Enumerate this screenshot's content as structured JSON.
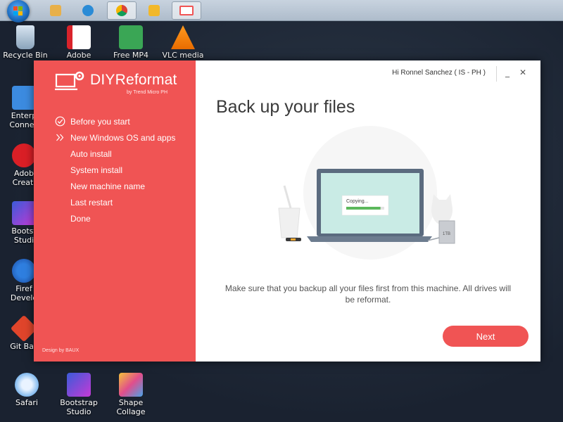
{
  "taskbar": {
    "items": [
      {
        "icon": "folder-icon",
        "color": "#e8b04a"
      },
      {
        "icon": "internet-explorer-icon",
        "color": "#2a8bd6"
      },
      {
        "icon": "chrome-icon",
        "color": "#db4437"
      },
      {
        "icon": "notes-icon",
        "color": "#f2b82a"
      },
      {
        "icon": "diyreformat-icon",
        "color": "#f05454"
      }
    ]
  },
  "desktop": {
    "icons_top": [
      {
        "label": "Recycle Bin",
        "icon": "recycle-bin-icon"
      },
      {
        "label": "Adobe",
        "icon": "adobe-icon"
      },
      {
        "label": "Free MP4",
        "icon": "free-mp4-icon"
      },
      {
        "label": "VLC media",
        "icon": "vlc-icon"
      }
    ],
    "icons_left": [
      {
        "label": "Enterp Connec",
        "icon": "enterprise-connect-icon"
      },
      {
        "label": "Adob Creati",
        "icon": "adobe-creative-icon"
      },
      {
        "label": "Bootst Studi",
        "icon": "bootstrap-studio-icon"
      },
      {
        "label": "Firef Develo",
        "icon": "firefox-developer-icon"
      },
      {
        "label": "Git Bas",
        "icon": "git-bash-icon"
      }
    ],
    "icons_bottom": [
      {
        "label": "Safari",
        "icon": "safari-icon"
      },
      {
        "label": "Bootstrap Studio",
        "icon": "bootstrap-studio-icon"
      },
      {
        "label": "Shape Collage",
        "icon": "shape-collage-icon"
      }
    ]
  },
  "app": {
    "logo": {
      "title": "DIYReformat",
      "subtitle": "by Trend Micro PH"
    },
    "steps": [
      {
        "label": "Before you start",
        "state": "done",
        "icon": "check-circle-icon"
      },
      {
        "label": "New Windows OS and apps",
        "state": "current",
        "icon": "double-chevron-icon"
      },
      {
        "label": "Auto install",
        "state": "pending",
        "icon": ""
      },
      {
        "label": "System install",
        "state": "pending",
        "icon": ""
      },
      {
        "label": "New machine name",
        "state": "pending",
        "icon": ""
      },
      {
        "label": "Last restart",
        "state": "pending",
        "icon": ""
      },
      {
        "label": "Done",
        "state": "pending",
        "icon": ""
      }
    ],
    "designed_by": "Design by BAUX",
    "user_greeting": "Hi Ronnel Sanchez ( IS - PH )",
    "controls": {
      "minimize": "_",
      "close": "✕"
    },
    "page_title": "Back up your files",
    "illustration": {
      "copying_label": "Copying...",
      "drive_label": "1TB",
      "progress": 0.9
    },
    "description": "Make sure that you backup all your files first from this machine. All drives will be reformat.",
    "next_label": "Next",
    "colors": {
      "accent": "#f05454",
      "progress": "#5cb85c"
    }
  }
}
